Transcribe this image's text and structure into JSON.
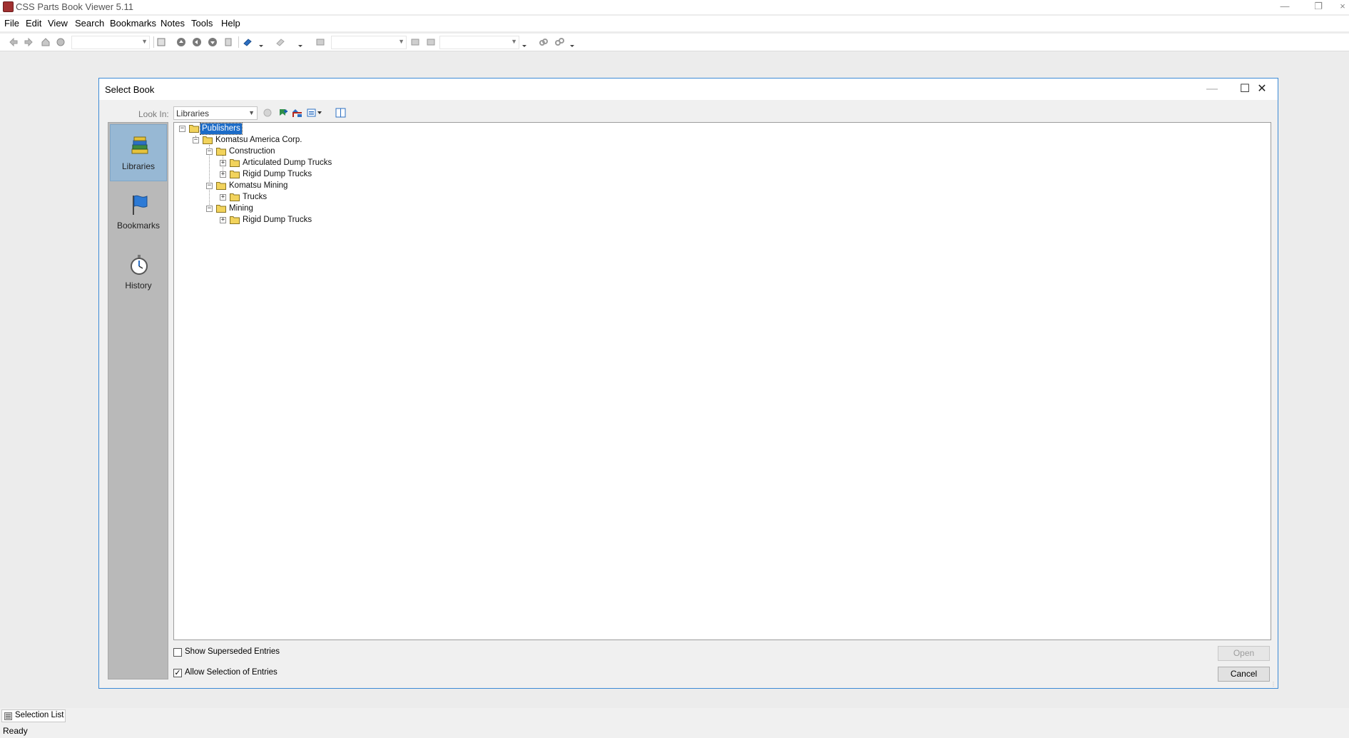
{
  "app": {
    "title": "CSS Parts Book Viewer 5.11",
    "window_controls": {
      "minimize": "—",
      "restore": "❐",
      "close": "×"
    }
  },
  "menu": [
    "File",
    "Edit",
    "View",
    "Search",
    "Bookmarks",
    "Notes",
    "Tools",
    "Help"
  ],
  "toolbar": {
    "icons": [
      "back-icon",
      "forward-icon",
      "home-icon",
      "refresh-icon",
      "print-icon",
      "first-page-icon",
      "previous-page-icon",
      "next-page-icon",
      "last-page-icon",
      "book-icon",
      "note-icon",
      "zoom-icon",
      "select-icon",
      "link-icon",
      "unlink-icon"
    ]
  },
  "dialog": {
    "title": "Select Book",
    "controls": {
      "minimize": "—",
      "maximize": "☐",
      "close": "✕"
    },
    "look_in_label": "Look In:",
    "look_in_value": "Libraries",
    "tools": [
      "back-icon",
      "add-bookmark-icon",
      "up-folder-icon",
      "view-menu-icon",
      "columns-icon"
    ],
    "sidebar": [
      {
        "label": "Libraries",
        "icon": "libraries-icon",
        "selected": true
      },
      {
        "label": "Bookmarks",
        "icon": "flag-icon",
        "selected": false
      },
      {
        "label": "History",
        "icon": "stopwatch-icon",
        "selected": false
      }
    ],
    "tree": {
      "publishers": "Publishers",
      "company": "Komatsu America Corp.",
      "construction": "Construction",
      "articulated_dump_trucks": "Articulated Dump Trucks",
      "rigid_dump_trucks_1": "Rigid Dump Trucks",
      "komatsu_mining": "Komatsu Mining",
      "trucks": "Trucks",
      "mining": "Mining",
      "rigid_dump_trucks_2": "Rigid Dump Trucks"
    },
    "options": {
      "show_superseded": {
        "label": "Show Superseded Entries",
        "checked": false
      },
      "allow_selection": {
        "label": "Allow Selection of Entries",
        "checked": true
      }
    },
    "buttons": {
      "open": "Open",
      "cancel": "Cancel"
    }
  },
  "panel": {
    "tab_label": "Selection List"
  },
  "status": {
    "text": "Ready"
  },
  "colors": {
    "selection": "#1c6cc8",
    "sidebar_selected": "#97b8d4",
    "dialog_border": "#3c8ad6",
    "folder": "#f2d35c"
  }
}
